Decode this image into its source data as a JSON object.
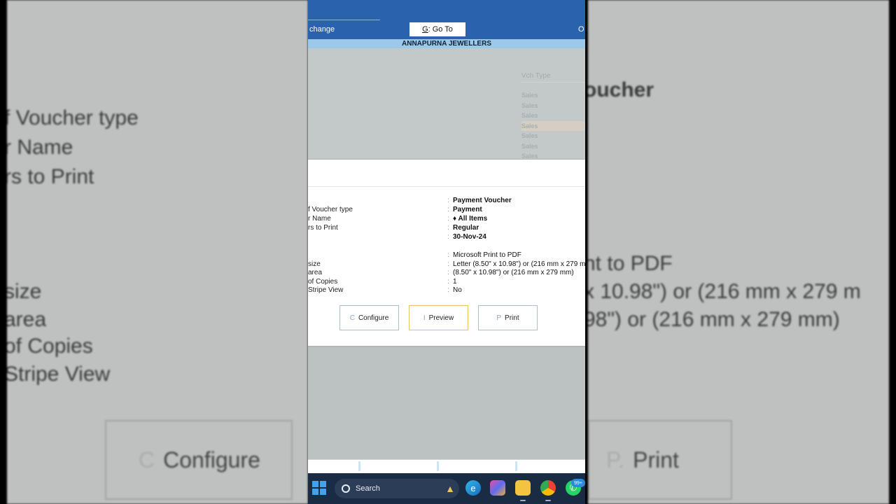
{
  "window": {
    "change_label": "change",
    "goto_key": "G",
    "goto_label": ": Go To",
    "right_key": "O",
    "company": "ANNAPURNA JEWELLERS"
  },
  "list": {
    "header": "Vch Type",
    "rows": [
      "Sales",
      "Sales",
      "Sales",
      "Sales",
      "Sales",
      "Sales",
      "Sales"
    ]
  },
  "print_dialog": {
    "top_value": "Payment Voucher",
    "fields": [
      {
        "label": "f Voucher type",
        "value": "Payment"
      },
      {
        "label": "r Name",
        "value": "♦ All Items"
      },
      {
        "label": "rs to Print",
        "value": "Regular"
      },
      {
        "label": "",
        "value": "30-Nov-24"
      },
      {
        "label": "",
        "value": "Microsoft Print to PDF"
      },
      {
        "label": "size",
        "value": "Letter (8.50\" x 10.98\") or (216 mm x 279 mm)"
      },
      {
        "label": "area",
        "value": "(8.50\" x 10.98\") or (216 mm x 279 mm)"
      },
      {
        "label": "of Copies",
        "value": "1"
      },
      {
        "label": "Stripe View",
        "value": "No"
      }
    ],
    "buttons": [
      {
        "key": "C",
        "label": "Configure"
      },
      {
        "key": "I",
        "label": "Preview"
      },
      {
        "key": "P",
        "label": "Print"
      }
    ]
  },
  "background": {
    "left_lines": [
      "f Voucher type",
      "r Name",
      "rs to Print",
      "size",
      "area",
      "of Copies",
      "Stripe View"
    ],
    "right_lines": [
      "oucher",
      "nt to PDF",
      "x 10.98\") or (216 mm x 279 m",
      "98\") or (216 mm x 279 mm)"
    ],
    "left_button": {
      "key": "C",
      "label": "Configure"
    },
    "right_button": {
      "key": "P.",
      "label": "Print"
    }
  },
  "taskbar": {
    "search_label": "Search",
    "badge": "99+",
    "icons": [
      "windows-start-icon",
      "edge-icon",
      "copilot-icon",
      "file-explorer-icon",
      "chrome-icon",
      "whatsapp-icon"
    ],
    "colors": {
      "taskbar": "#1a2b44",
      "accent": "#3fa3f0"
    }
  },
  "colors": {
    "titlebar": "#2a62ad",
    "company_bar": "#9cc9ea",
    "dialog": "#ffffff",
    "focus_border": "#e4c563"
  }
}
